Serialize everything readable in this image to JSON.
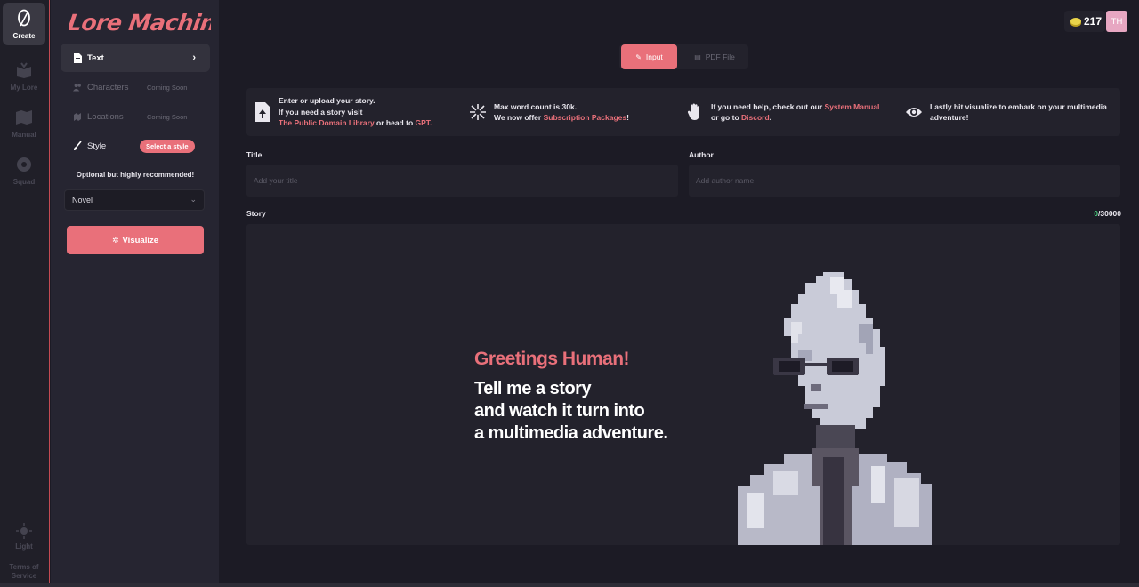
{
  "rail": {
    "items": [
      {
        "label": "Create",
        "icon": "quill-icon",
        "active": true
      },
      {
        "label": "My Lore",
        "icon": "book-icon",
        "active": false
      },
      {
        "label": "Manual",
        "icon": "map-icon",
        "active": false
      },
      {
        "label": "Squad",
        "icon": "gear-badge-icon",
        "active": false
      }
    ],
    "light_label": "Light",
    "terms_label": "Terms of Service"
  },
  "sidebar": {
    "logo_text": "Lore Machine",
    "menu": [
      {
        "label": "Text",
        "icon": "document-icon"
      },
      {
        "label": "Characters",
        "icon": "users-icon",
        "badge": "Coming Soon"
      },
      {
        "label": "Locations",
        "icon": "pin-icon",
        "badge": "Coming Soon"
      },
      {
        "label": "Style",
        "icon": "brush-icon",
        "badge": "Select a style"
      }
    ],
    "optional_note": "Optional but highly recommended!",
    "style_select_value": "Novel",
    "visualize_label": "Visualize"
  },
  "header": {
    "credits": "217",
    "avatar_initials": "TH"
  },
  "tabs": {
    "input_label": "Input",
    "pdf_label": "PDF File"
  },
  "info": {
    "upload_line1": "Enter or upload your story.",
    "upload_line2": "If you need a story visit",
    "upload_link1": "The Public Domain Library",
    "upload_mid": " or head to ",
    "upload_link2": "GPT.",
    "words_line1": "Max word count is 30k.",
    "words_line2": "We now offer ",
    "words_link": "Subscription Packages",
    "words_end": "!",
    "help_line1": "If you need help, check out our ",
    "help_link1": "System Manual",
    "help_line2": "or go to ",
    "help_link2": "Discord",
    "help_end": ".",
    "visualize_line1": "Lastly hit visualize to embark on your multimedia",
    "visualize_line2": "adventure!"
  },
  "form": {
    "title_label": "Title",
    "title_placeholder": "Add your title",
    "author_label": "Author",
    "author_placeholder": "Add author name",
    "story_label": "Story",
    "count_current": "0",
    "count_max": "/30000"
  },
  "hero": {
    "greeting": "Greetings Human!",
    "line1": "Tell me a story",
    "line2": "and watch it turn into",
    "line3": "a multimedia adventure."
  },
  "colors": {
    "accent": "#e9707a",
    "background": "#1c1b25",
    "panel": "#23222c",
    "counter_green": "#45c47a"
  }
}
